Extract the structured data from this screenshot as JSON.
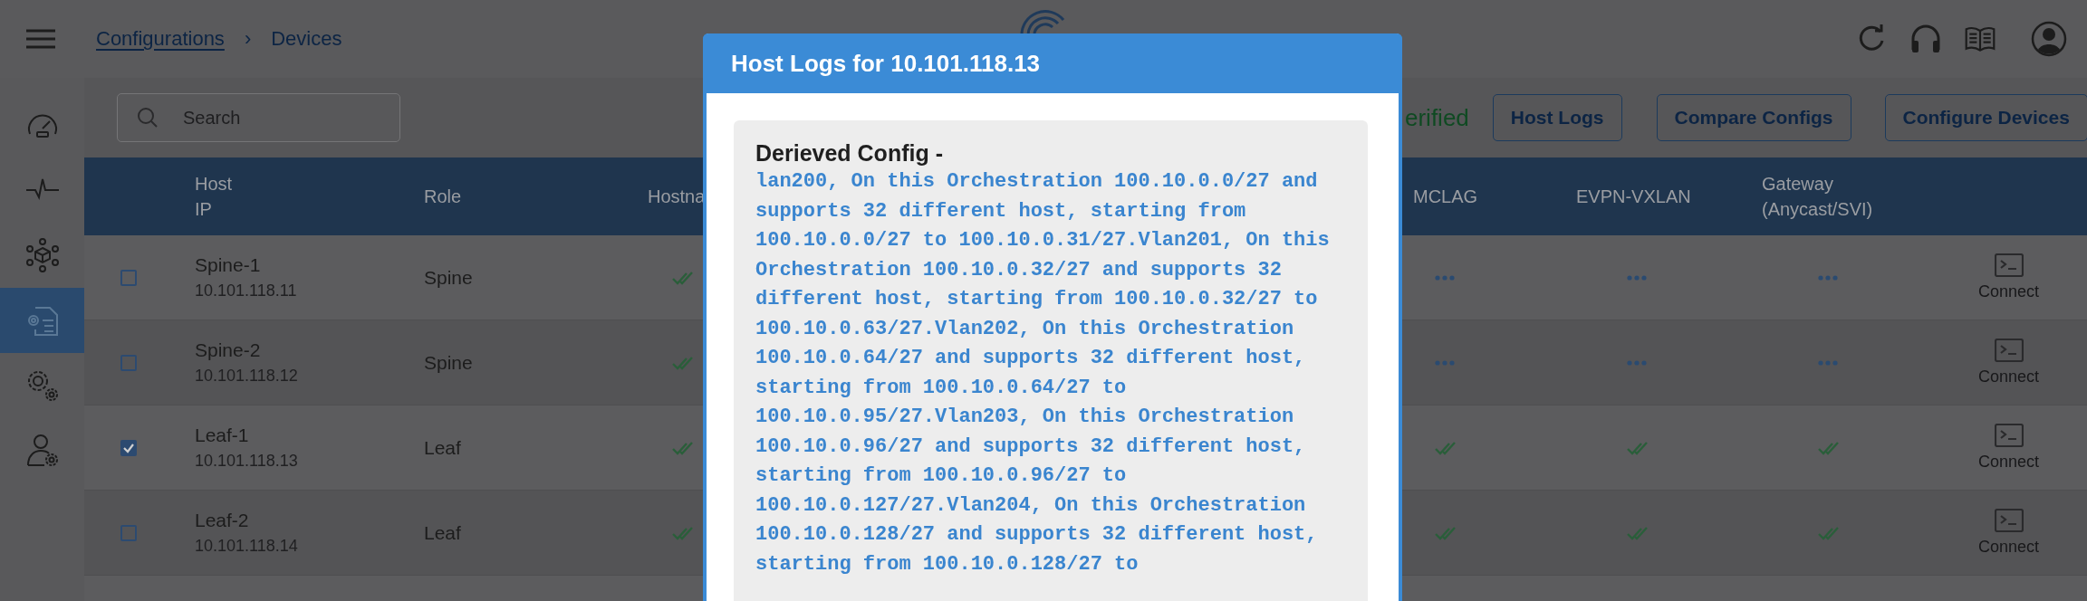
{
  "header": {
    "breadcrumb": [
      {
        "label": "Configurations",
        "link": true
      },
      {
        "label": "Devices",
        "link": false
      }
    ],
    "separator": "›"
  },
  "sidebar": {
    "items": [
      {
        "kind": "dashboard",
        "selected": false
      },
      {
        "kind": "pulse",
        "selected": false
      },
      {
        "kind": "network",
        "selected": false
      },
      {
        "kind": "config",
        "selected": true
      },
      {
        "kind": "settings",
        "selected": false
      },
      {
        "kind": "user",
        "selected": false
      }
    ]
  },
  "toolbar": {
    "search": {
      "placeholder": "Search"
    },
    "status": "erified",
    "buttons": [
      "Host Logs",
      "Compare Configs",
      "Configure Devices"
    ]
  },
  "table": {
    "columns": [
      "Host\nIP",
      "Role",
      "Hostna",
      "MCLAG",
      "EVPN-VXLAN",
      "Gateway\n(Anycast/SVI)"
    ],
    "rows": [
      {
        "checked": false,
        "name": "Spine-1",
        "ip": "10.101.118.11",
        "role": "Spine",
        "verified": [
          true,
          false,
          false,
          false
        ],
        "action": "Connect"
      },
      {
        "checked": false,
        "name": "Spine-2",
        "ip": "10.101.118.12",
        "role": "Spine",
        "verified": [
          true,
          false,
          false,
          false
        ],
        "action": "Connect"
      },
      {
        "checked": true,
        "name": "Leaf-1",
        "ip": "10.101.118.13",
        "role": "Leaf",
        "verified": [
          true,
          true,
          true,
          true
        ],
        "action": "Connect"
      },
      {
        "checked": false,
        "name": "Leaf-2",
        "ip": "10.101.118.14",
        "role": "Leaf",
        "verified": [
          true,
          true,
          true,
          true
        ],
        "action": "Connect"
      }
    ]
  },
  "modal": {
    "title": "Host Logs for 10.101.118.13",
    "heading": "Derieved Config -",
    "text": "lan200, On this Orchestration 100.10.0.0/27 and supports 32 different host, starting from 100.10.0.0/27 to 100.10.0.31/27.Vlan201, On this Orchestration 100.10.0.32/27 and supports 32 different host, starting from 100.10.0.32/27 to 100.10.0.63/27.Vlan202, On this Orchestration 100.10.0.64/27 and supports 32 different host, starting from 100.10.0.64/27 to 100.10.0.95/27.Vlan203, On this Orchestration 100.10.0.96/27 and supports 32 different host, starting from 100.10.0.96/27 to 100.10.0.127/27.Vlan204, On this Orchestration 100.10.0.128/27 and supports 32 different host, starting from 100.10.0.128/27 to"
  }
}
